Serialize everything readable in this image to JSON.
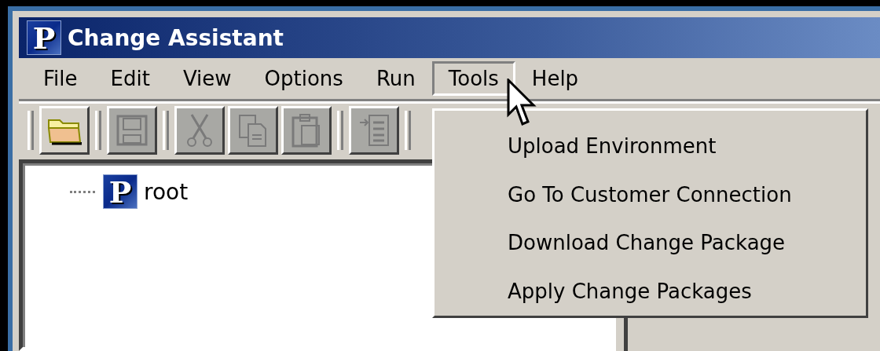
{
  "window": {
    "title": "Change Assistant",
    "logo_letter": "P"
  },
  "menu_bar": [
    {
      "label": "File",
      "selected": false
    },
    {
      "label": "Edit",
      "selected": false
    },
    {
      "label": "View",
      "selected": false
    },
    {
      "label": "Options",
      "selected": false
    },
    {
      "label": "Run",
      "selected": false
    },
    {
      "label": "Tools",
      "selected": true
    },
    {
      "label": "Help",
      "selected": false
    }
  ],
  "toolbar": [
    {
      "kind": "open",
      "disabled": false
    },
    {
      "kind": "separator"
    },
    {
      "kind": "save",
      "disabled": true
    },
    {
      "kind": "separator"
    },
    {
      "kind": "cut",
      "disabled": true
    },
    {
      "kind": "copy",
      "disabled": true
    },
    {
      "kind": "paste",
      "disabled": true
    },
    {
      "kind": "separator"
    },
    {
      "kind": "insert",
      "disabled": true
    },
    {
      "kind": "separator"
    }
  ],
  "tree": [
    {
      "label": "root",
      "logo_letter": "P"
    }
  ],
  "dropdown_menu": {
    "items": [
      "Upload Environment",
      "Go To Customer Connection",
      "Download Change Package",
      "Apply Change Packages"
    ]
  }
}
